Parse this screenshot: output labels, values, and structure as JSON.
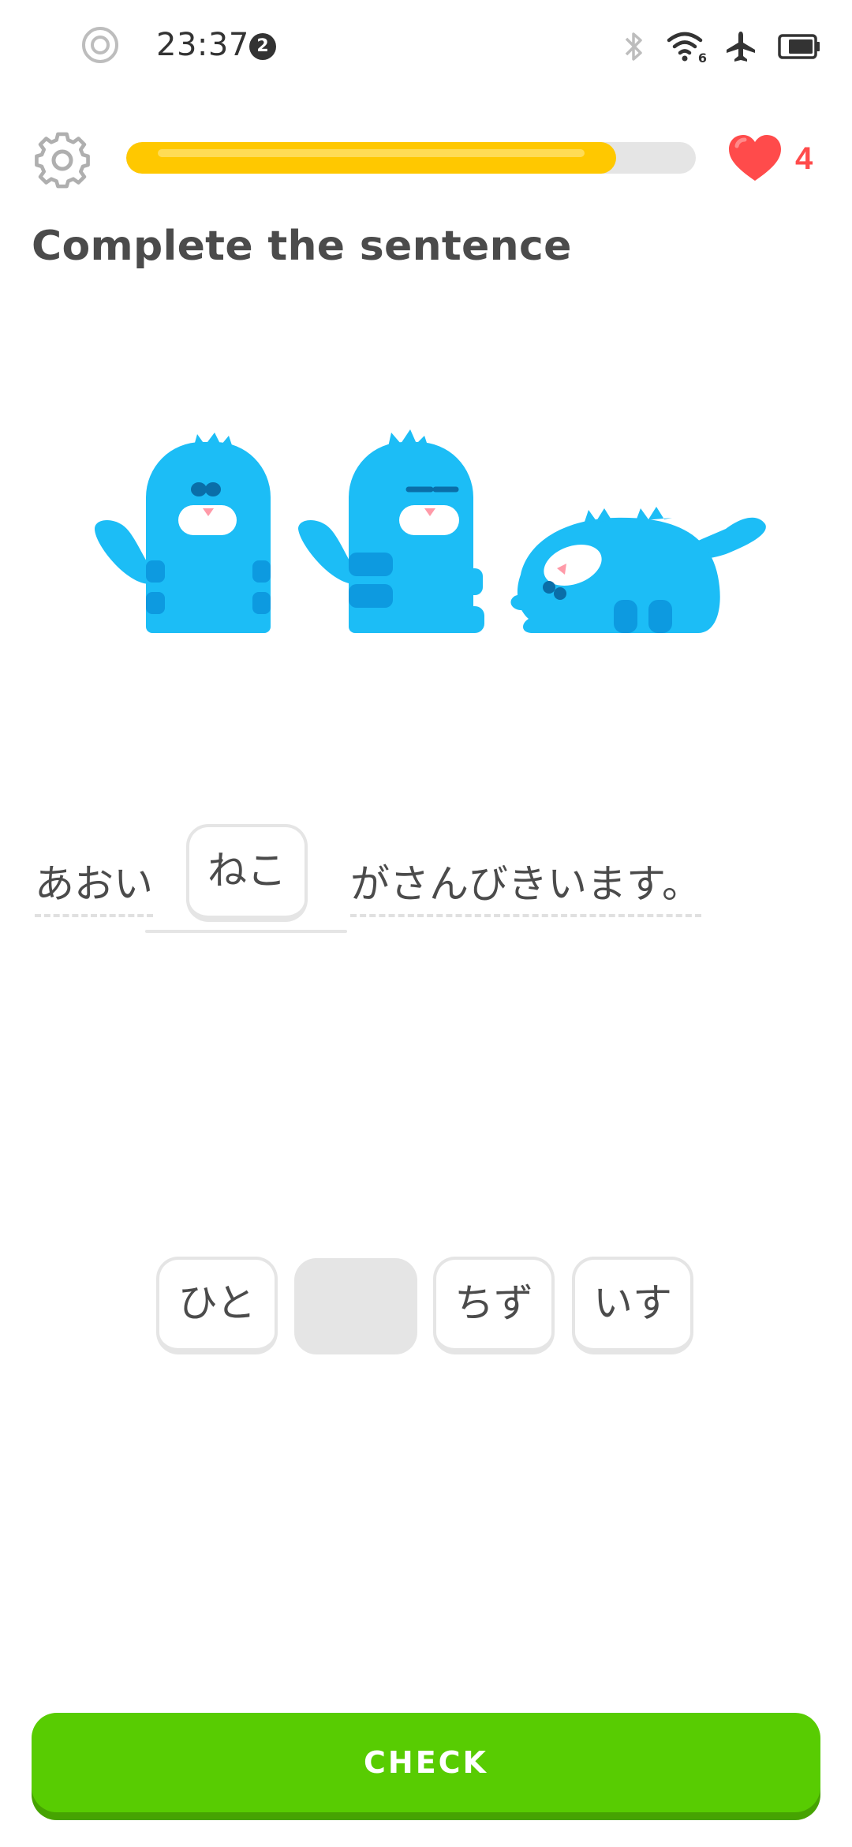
{
  "status_bar": {
    "time": "23:37",
    "notification_count": "2",
    "wifi_label": "6"
  },
  "lesson": {
    "progress": 0.86,
    "hearts": "4",
    "title": "Complete the sentence"
  },
  "sentence": {
    "prefix": "あおい",
    "answer": "ねこ",
    "suffix": "がさんびきいます。"
  },
  "word_bank": {
    "options": [
      "ひと",
      "",
      "ちず",
      "いす"
    ]
  },
  "actions": {
    "check_label": "CHECK"
  },
  "colors": {
    "progress": "#ffc800",
    "heart": "#ff4b4b",
    "check": "#58cc02",
    "character": "#1cb0f6"
  }
}
